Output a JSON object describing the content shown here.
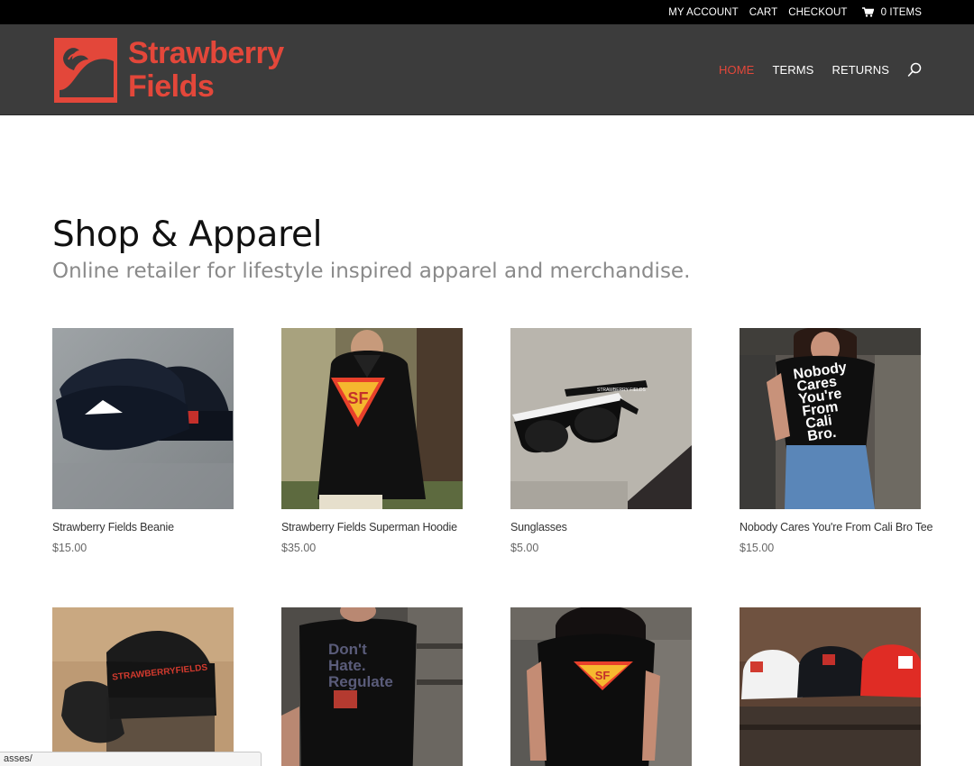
{
  "topbar": {
    "links": [
      "MY ACCOUNT",
      "CART",
      "CHECKOUT"
    ],
    "cart_count": "0 ITEMS"
  },
  "header": {
    "logo_line1": "Strawberry",
    "logo_line2": "Fields",
    "nav": [
      {
        "label": "HOME",
        "active": true
      },
      {
        "label": "TERMS",
        "active": false
      },
      {
        "label": "RETURNS",
        "active": false
      }
    ]
  },
  "page": {
    "title": "Shop & Apparel",
    "subtitle": "Online retailer for lifestyle inspired apparel and merchandise."
  },
  "products": [
    {
      "name": "Strawberry Fields Beanie",
      "price": "$15.00",
      "image": "beanie"
    },
    {
      "name": "Strawberry Fields Superman Hoodie",
      "price": "$35.00",
      "image": "hoodie"
    },
    {
      "name": "Sunglasses",
      "price": "$5.00",
      "image": "sunglasses"
    },
    {
      "name": "Nobody Cares You're From Cali Bro Tee",
      "price": "$15.00",
      "image": "tee"
    },
    {
      "name": "",
      "price": "",
      "image": "trucker-hat"
    },
    {
      "name": "",
      "price": "",
      "image": "regulate-tee"
    },
    {
      "name": "",
      "price": "",
      "image": "superman-tee"
    },
    {
      "name": "",
      "price": "",
      "image": "caps"
    }
  ],
  "image_text": {
    "tee_text": [
      "Nobody",
      "Cares",
      "You're",
      "From",
      "Cali",
      "Bro."
    ],
    "regulate_text": [
      "Don't",
      "Hate.",
      "Regulate"
    ],
    "trucker_text": "STRAWBERRYFIELDS"
  },
  "statusbar": {
    "text": "asses/"
  },
  "colors": {
    "brand": "#e3473a",
    "header_bg": "#3c3c3c",
    "topbar_bg": "#000000"
  }
}
